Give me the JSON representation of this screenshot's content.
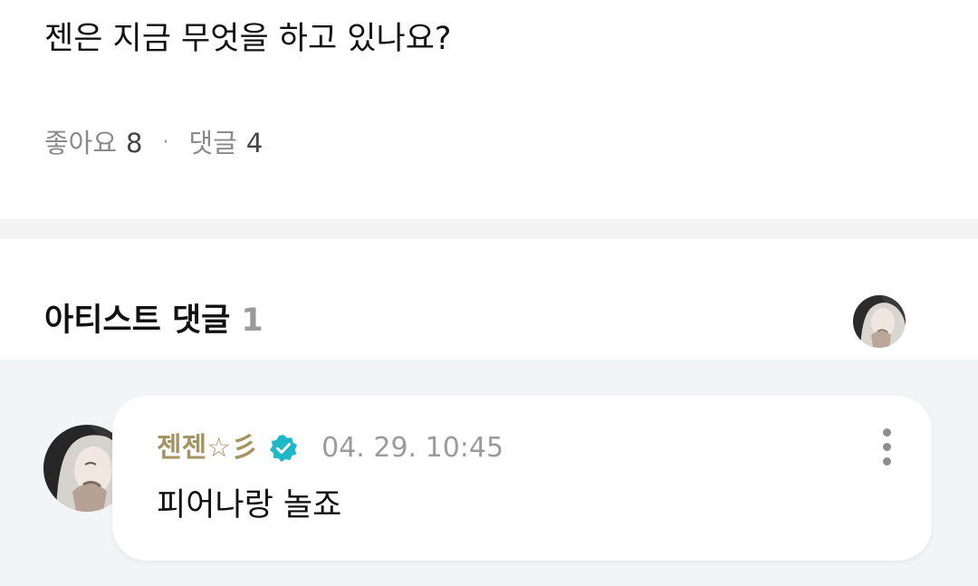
{
  "post": {
    "text": "젠은 지금 무엇을 하고 있나요?",
    "likes_label": "좋아요",
    "likes_count": "8",
    "separator": "·",
    "comments_label": "댓글",
    "comments_count": "4"
  },
  "artist_comments": {
    "title": "아티스트 댓글",
    "count": "1",
    "comment": {
      "author": "젠젠☆彡",
      "timestamp": "04. 29. 10:45",
      "text": "피어나랑 놀죠",
      "verified_icon": "verified-badge-icon",
      "more_icon": "more-vertical-icon"
    }
  },
  "colors": {
    "author": "#a59462",
    "verified": "#1fb8c8",
    "muted": "#8a8a8a",
    "section_gap": "#f4f4f4",
    "comment_bg": "#f3f4f6"
  }
}
